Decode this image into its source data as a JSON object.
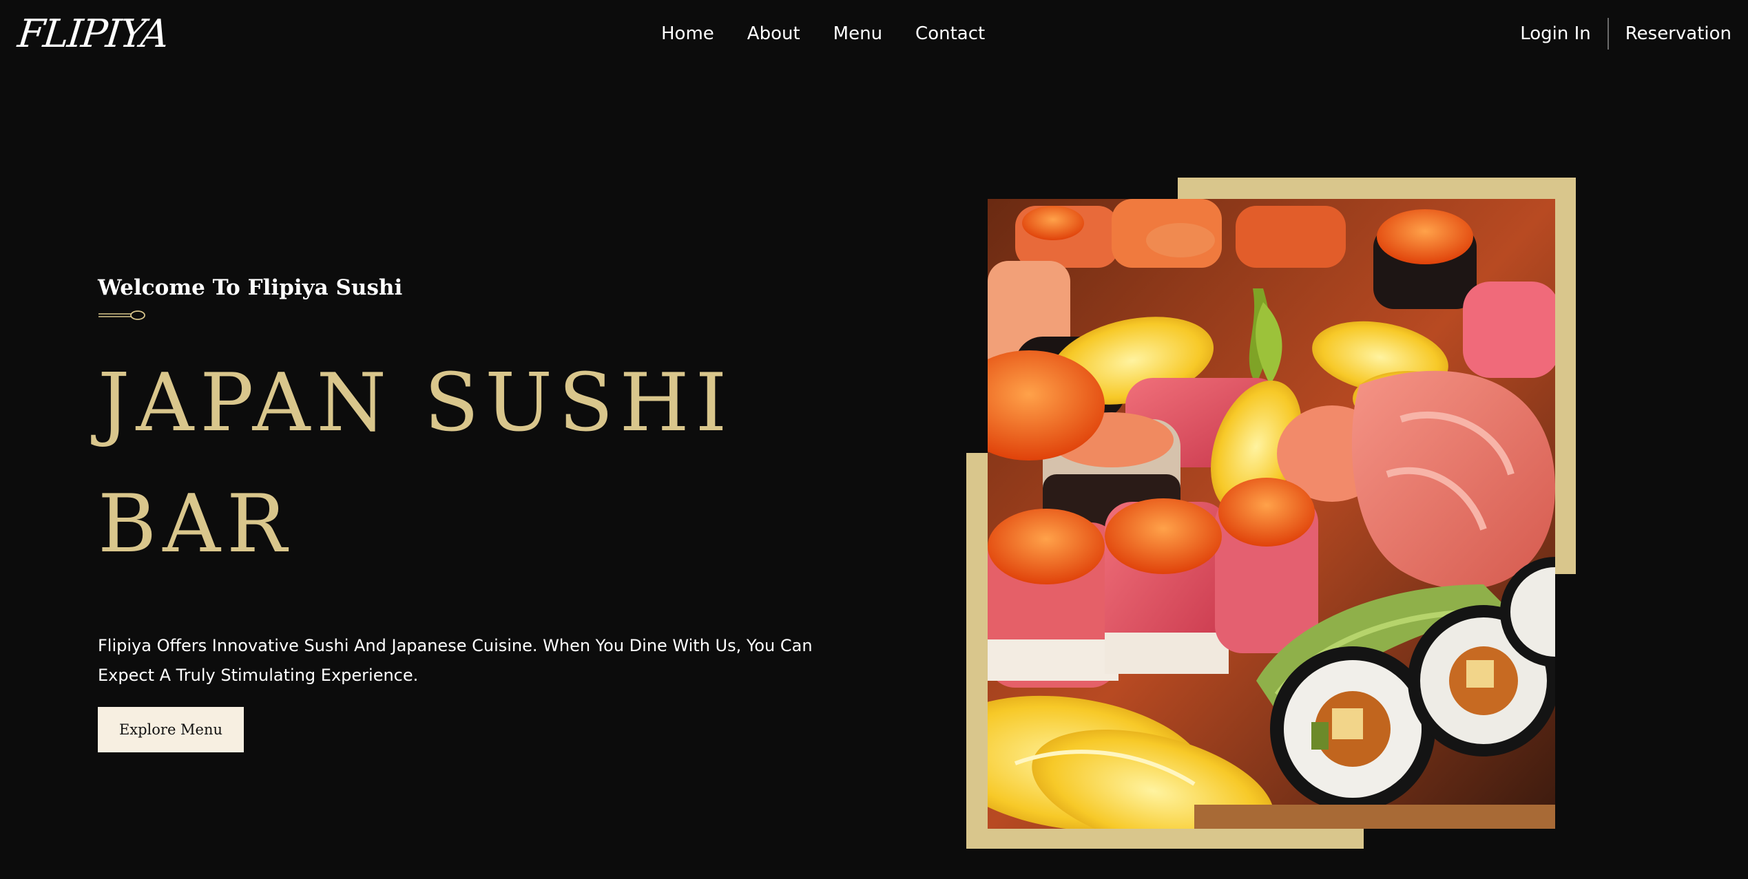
{
  "header": {
    "logo": "FLIPIYA",
    "nav": [
      "Home",
      "About",
      "Menu",
      "Contact"
    ],
    "login_label": "Login In",
    "reservation_label": "Reservation"
  },
  "hero": {
    "welcome": "Welcome To Flipiya Sushi",
    "title_line1": "JAPAN SUSHI",
    "title_line2": "BAR",
    "description": "Flipiya Offers Innovative Sushi And Japanese Cuisine. When You Dine With Us, You Can Expect A Truly Stimulating Experience.",
    "cta_label": "Explore Menu"
  },
  "colors": {
    "background": "#0c0c0c",
    "accent_gold": "#d9c68c",
    "button_bg": "#f7efe1",
    "text": "#ffffff"
  },
  "icons": {
    "divider": "spoon-icon"
  }
}
